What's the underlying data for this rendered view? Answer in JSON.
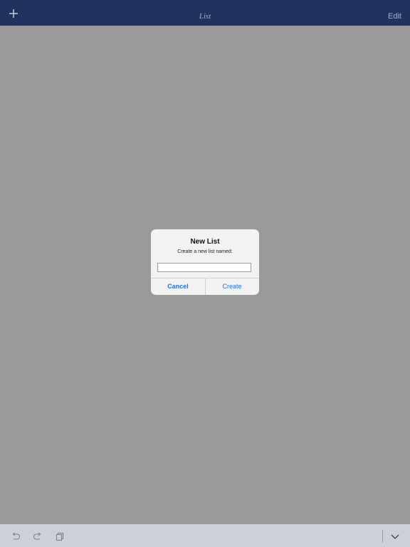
{
  "navbar": {
    "title": "List",
    "add_icon": "plus-icon",
    "edit_label": "Edit"
  },
  "alert": {
    "title": "New List",
    "message": "Create a new list named:",
    "input_value": "",
    "input_placeholder": "",
    "cancel_label": "Cancel",
    "create_label": "Create"
  },
  "toolbar": {
    "icons": [
      "undo-icon",
      "redo-icon",
      "copy-icon",
      "chevron-down-icon"
    ]
  },
  "colors": {
    "navbar": "#22325f",
    "background_dim": "#9a9a9a",
    "accent": "#1d73e6",
    "toolbar": "#cdd0d6"
  }
}
